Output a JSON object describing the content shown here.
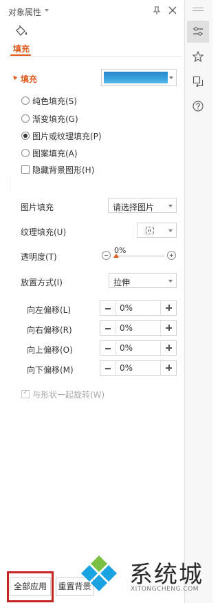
{
  "header": {
    "title": "对象属性"
  },
  "tabs": [
    {
      "label": "填充",
      "active": true
    }
  ],
  "fill_section": {
    "title": "填充",
    "color_preview": "#38a0de",
    "options": [
      {
        "label": "纯色填充(S)",
        "selected": false
      },
      {
        "label": "渐变填充(G)",
        "selected": false
      },
      {
        "label": "图片或纹理填充(P)",
        "selected": true
      },
      {
        "label": "图案填充(A)",
        "selected": false
      }
    ],
    "hide_background": {
      "label": "隐藏背景图形(H)",
      "checked": false
    }
  },
  "picture_fill": {
    "label": "图片填充",
    "value": "请选择图片"
  },
  "texture_fill": {
    "label": "纹理填充(U)"
  },
  "transparency": {
    "label": "透明度(T)",
    "value": "0%",
    "fraction": 0
  },
  "placement": {
    "label": "放置方式(I)",
    "value": "拉伸"
  },
  "offsets": [
    {
      "label": "向左偏移(L)",
      "value": "0%"
    },
    {
      "label": "向右偏移(R)",
      "value": "0%"
    },
    {
      "label": "向上偏移(O)",
      "value": "0%"
    },
    {
      "label": "向下偏移(M)",
      "value": "0%"
    }
  ],
  "rotate_with_shape": {
    "label": "与形状一起旋转(W)",
    "checked": true,
    "disabled": true
  },
  "footer": {
    "apply_all": "全部应用",
    "reset_background": "重置背景"
  },
  "watermark": {
    "name": "系统城",
    "url": "XITONGCHENG.COM"
  },
  "colors": {
    "accent": "#e05a1b",
    "highlight": "#c6231f"
  },
  "sidebar_icons": [
    "properties-icon",
    "star-icon",
    "transform-icon",
    "help-icon"
  ]
}
